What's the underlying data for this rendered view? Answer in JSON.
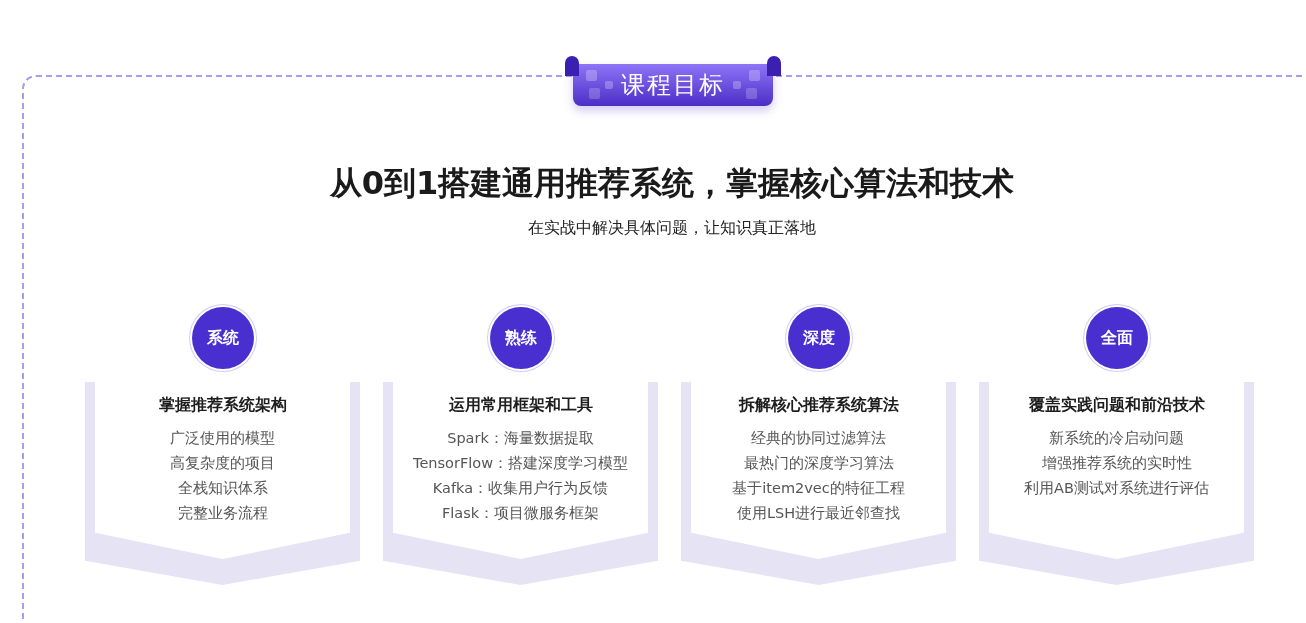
{
  "ribbon": {
    "label": "课程目标"
  },
  "title": "从0到1搭建通用推荐系统，掌握核心算法和技术",
  "subtitle": "在实战中解决具体问题，让知识真正落地",
  "cards": [
    {
      "badge": "系统",
      "title": "掌握推荐系统架构",
      "items": [
        "广泛使用的模型",
        "高复杂度的项目",
        "全栈知识体系",
        "完整业务流程"
      ]
    },
    {
      "badge": "熟练",
      "title": "运用常用框架和工具",
      "items": [
        "Spark：海量数据提取",
        "TensorFlow：搭建深度学习模型",
        "Kafka：收集用户行为反馈",
        "Flask：项目微服务框架"
      ]
    },
    {
      "badge": "深度",
      "title": "拆解核心推荐系统算法",
      "items": [
        "经典的协同过滤算法",
        "最热门的深度学习算法",
        "基于item2vec的特征工程",
        "使用LSH进行最近邻查找"
      ]
    },
    {
      "badge": "全面",
      "title": "覆盖实践问题和前沿技术",
      "items": [
        "新系统的冷启动问题",
        "增强推荐系统的实时性",
        "利用AB测试对系统进行评估"
      ]
    }
  ]
}
